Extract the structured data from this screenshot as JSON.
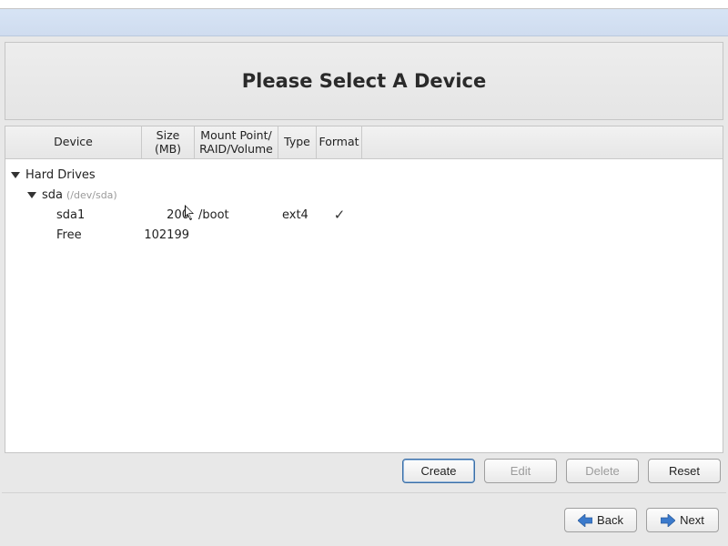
{
  "title": "Please Select A Device",
  "columns": {
    "device": "Device",
    "size": "Size (MB)",
    "mount": "Mount Point/ RAID/Volume",
    "type": "Type",
    "format": "Format"
  },
  "tree": {
    "root_label": "Hard Drives",
    "disk": {
      "name": "sda",
      "path": "(/dev/sda)",
      "partitions": [
        {
          "name": "sda1",
          "size": "200",
          "mount": "/boot",
          "type": "ext4",
          "format": true
        },
        {
          "name": "Free",
          "size": "102199",
          "mount": "",
          "type": "",
          "format": false
        }
      ]
    }
  },
  "buttons": {
    "create": "Create",
    "edit": "Edit",
    "delete": "Delete",
    "reset": "Reset",
    "back": "Back",
    "next": "Next"
  }
}
